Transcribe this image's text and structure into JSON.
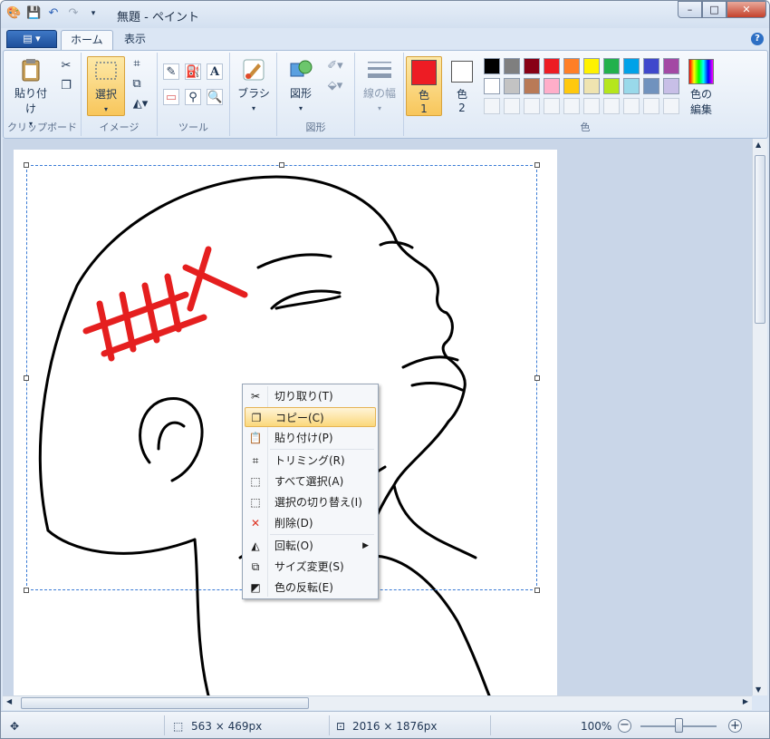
{
  "window": {
    "title": "無題 - ペイント"
  },
  "tabs": {
    "file": "▤ ▾",
    "home": "ホーム",
    "view": "表示"
  },
  "ribbon": {
    "clipboard": {
      "paste": "貼り付け",
      "label": "クリップボード"
    },
    "image": {
      "select": "選択",
      "label": "イメージ"
    },
    "tools": {
      "label": "ツール"
    },
    "brush": {
      "label": "ブラシ"
    },
    "shapes": {
      "shapes": "図形",
      "label": "図形"
    },
    "size": {
      "label": "線の幅"
    },
    "colors": {
      "color1": "色\n1",
      "color1_a": "色",
      "color1_b": "1",
      "color2_a": "色",
      "color2_b": "2",
      "edit_a": "色の",
      "edit_b": "編集",
      "label": "色",
      "color1_value": "#ed1c24",
      "color2_value": "#ffffff",
      "palette_row1": [
        "#000000",
        "#7f7f7f",
        "#880015",
        "#ed1c24",
        "#ff7f27",
        "#fff200",
        "#22b14c",
        "#00a2e8",
        "#3f48cc",
        "#a349a4"
      ],
      "palette_row2": [
        "#ffffff",
        "#c3c3c3",
        "#b97a57",
        "#ffaec9",
        "#ffc90e",
        "#efe4b0",
        "#b5e61d",
        "#99d9ea",
        "#7092be",
        "#c8bfe7"
      ]
    }
  },
  "context_menu": {
    "items": [
      {
        "label": "切り取り(T)",
        "icon": "scissors-icon"
      },
      {
        "label": "コピー(C)",
        "icon": "copy-icon"
      },
      {
        "label": "貼り付け(P)",
        "icon": "paste-icon"
      },
      {
        "label": "トリミング(R)",
        "icon": "crop-icon"
      },
      {
        "label": "すべて選択(A)",
        "icon": "select-all-icon"
      },
      {
        "label": "選択の切り替え(I)",
        "icon": "invert-selection-icon"
      },
      {
        "label": "削除(D)",
        "icon": "delete-icon"
      },
      {
        "label": "回転(O)",
        "icon": "rotate-icon"
      },
      {
        "label": "サイズ変更(S)",
        "icon": "resize-icon"
      },
      {
        "label": "色の反転(E)",
        "icon": "invert-color-icon"
      }
    ]
  },
  "status": {
    "selection_size": "563 × 469px",
    "image_size": "2016 × 1876px",
    "zoom": "100%"
  }
}
